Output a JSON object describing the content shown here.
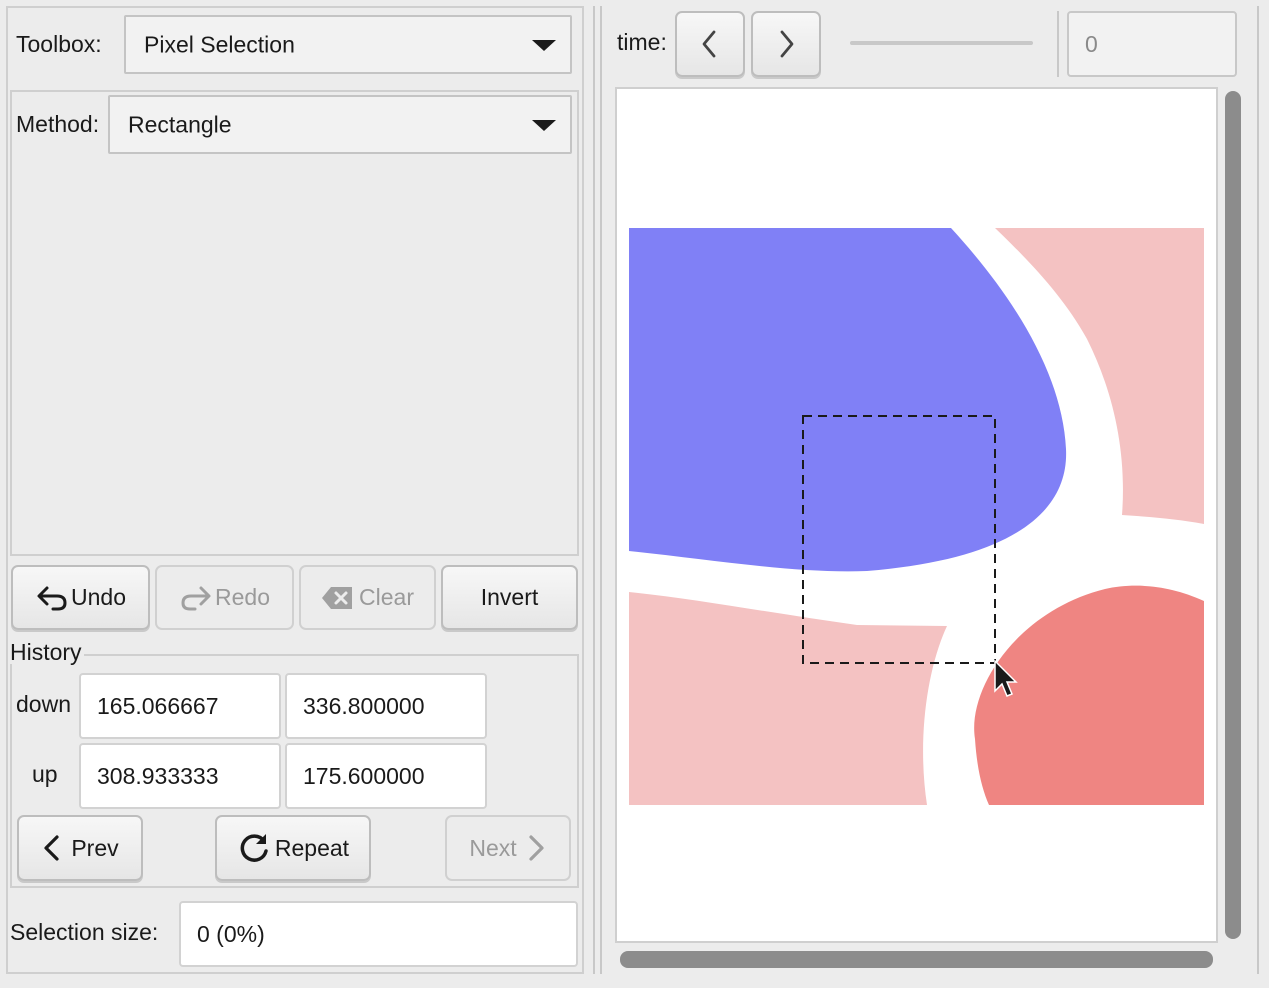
{
  "toolbox": {
    "label": "Toolbox:",
    "value": "Pixel Selection"
  },
  "method": {
    "label": "Method:",
    "value": "Rectangle"
  },
  "actions": {
    "undo": "Undo",
    "redo": "Redo",
    "clear": "Clear",
    "invert": "Invert"
  },
  "history": {
    "title": "History",
    "down": {
      "label": "down",
      "x": "165.066667",
      "y": "336.800000"
    },
    "up": {
      "label": "up",
      "x": "308.933333",
      "y": "175.600000"
    },
    "prev": "Prev",
    "repeat": "Repeat",
    "next": "Next"
  },
  "selection": {
    "label": "Selection size:",
    "value": "0 (0%)"
  },
  "time": {
    "label": "time:",
    "value": "0"
  },
  "icons": {
    "undo": "undo-arrow-icon",
    "redo": "redo-arrow-icon",
    "clear": "backspace-x-icon",
    "prev": "chevron-left-icon",
    "next": "chevron-right-icon",
    "repeat": "circular-arrow-icon",
    "time_prev": "chevron-left-icon",
    "time_next": "chevron-right-icon",
    "cursor": "mouse-pointer-icon"
  },
  "colors": {
    "blue_region": "#8080f6",
    "light_red_region": "#f4c2c2",
    "red_region": "#ef8582",
    "panel_bg": "#ececec",
    "scrollbar": "#8c8c8c"
  }
}
